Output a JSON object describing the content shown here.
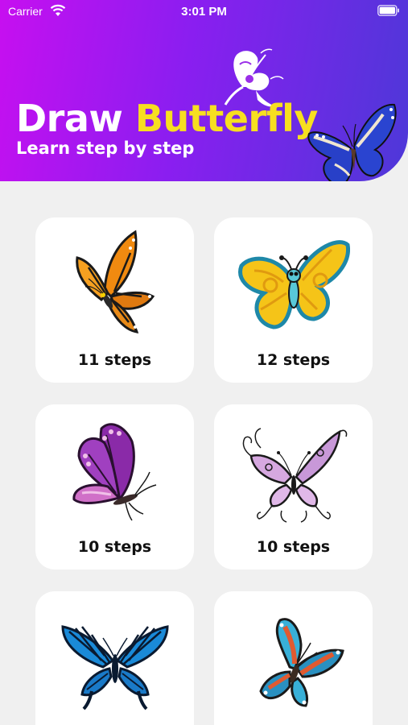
{
  "status_bar": {
    "carrier": "Carrier",
    "time": "3:01 PM"
  },
  "header": {
    "title_part1": "Draw ",
    "title_part2": "Butterfly",
    "subtitle": "Learn step by step"
  },
  "cards": [
    {
      "steps_label": "11 steps",
      "icon": "monarch-butterfly-icon"
    },
    {
      "steps_label": "12 steps",
      "icon": "cartoon-butterfly-icon"
    },
    {
      "steps_label": "10 steps",
      "icon": "purple-butterfly-icon"
    },
    {
      "steps_label": "10 steps",
      "icon": "ornate-butterfly-icon"
    },
    {
      "steps_label": "",
      "icon": "swallowtail-butterfly-icon"
    },
    {
      "steps_label": "",
      "icon": "teal-butterfly-icon"
    }
  ],
  "colors": {
    "header_gradient": [
      "#c70ff0",
      "#8a1ef0",
      "#4d38d8"
    ],
    "title_accent": "#f7df20",
    "background": "#f0f0f0",
    "card": "#ffffff"
  }
}
